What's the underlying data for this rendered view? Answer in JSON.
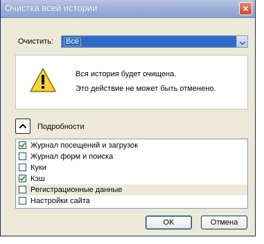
{
  "window": {
    "title": "Очистка всей истории",
    "close_glyph": "×"
  },
  "clear": {
    "label": "Очистить:",
    "selected": "Всё"
  },
  "info": {
    "icon": "warning-icon",
    "line1": "Вся история будет очищена.",
    "line2": "Это действие не может быть отменено."
  },
  "details": {
    "label": "Подробности",
    "expanded": true
  },
  "items": [
    {
      "label": "Журнал посещений и загрузок",
      "checked": true
    },
    {
      "label": "Журнал форм и поиска",
      "checked": false
    },
    {
      "label": "Куки",
      "checked": false
    },
    {
      "label": "Кэш",
      "checked": true
    },
    {
      "label": "Регистрационные данные",
      "checked": false
    },
    {
      "label": "Настройки сайта",
      "checked": false
    }
  ],
  "buttons": {
    "ok": "OK",
    "cancel": "Отмена"
  },
  "colors": {
    "selection": "#316ac5",
    "dialog_bg": "#ece9d8",
    "checkmark": "#21a121"
  }
}
